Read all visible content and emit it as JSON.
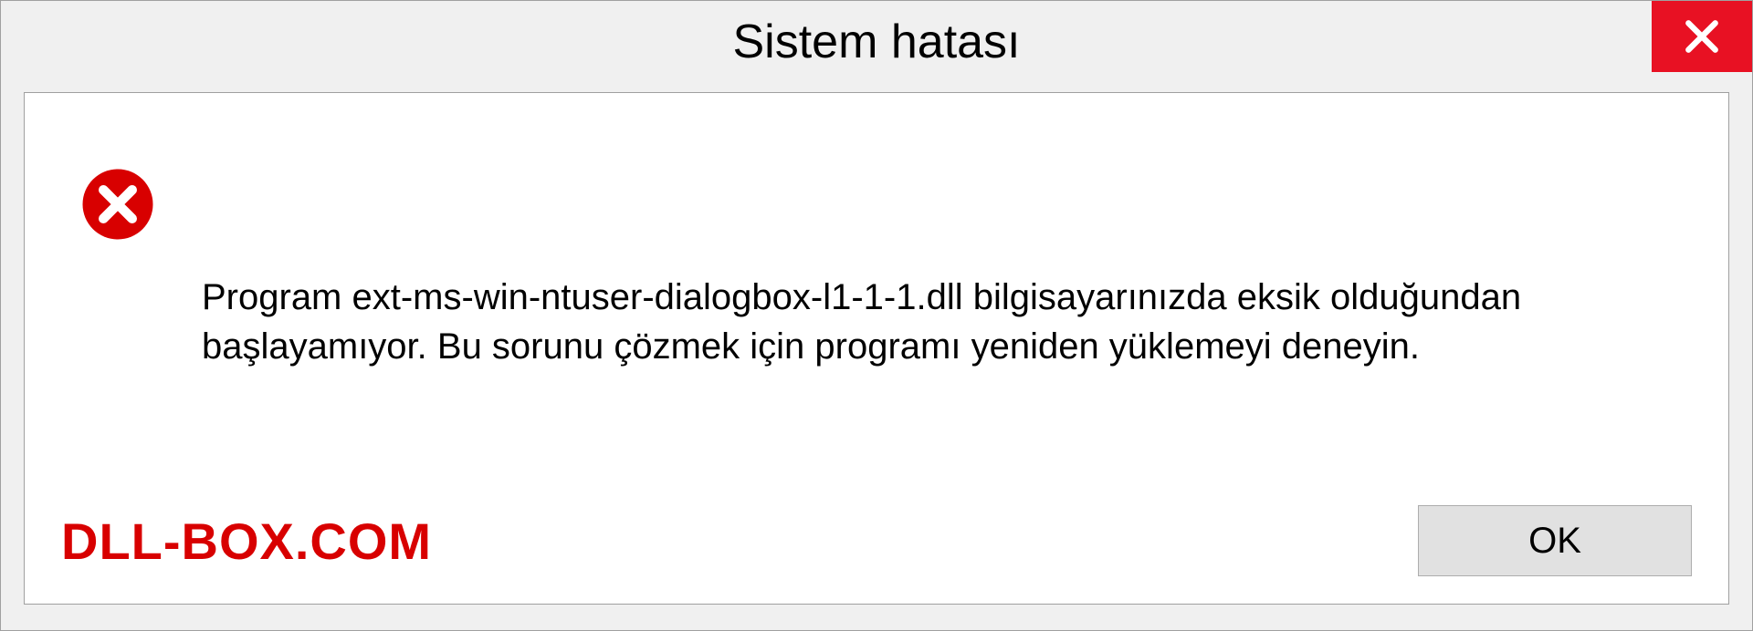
{
  "dialog": {
    "title": "Sistem hatası",
    "message": "Program ext-ms-win-ntuser-dialogbox-l1-1-1.dll bilgisayarınızda eksik olduğundan başlayamıyor. Bu sorunu çözmek için programı yeniden yüklemeyi deneyin.",
    "ok_label": "OK"
  },
  "watermark": "DLL-BOX.COM"
}
